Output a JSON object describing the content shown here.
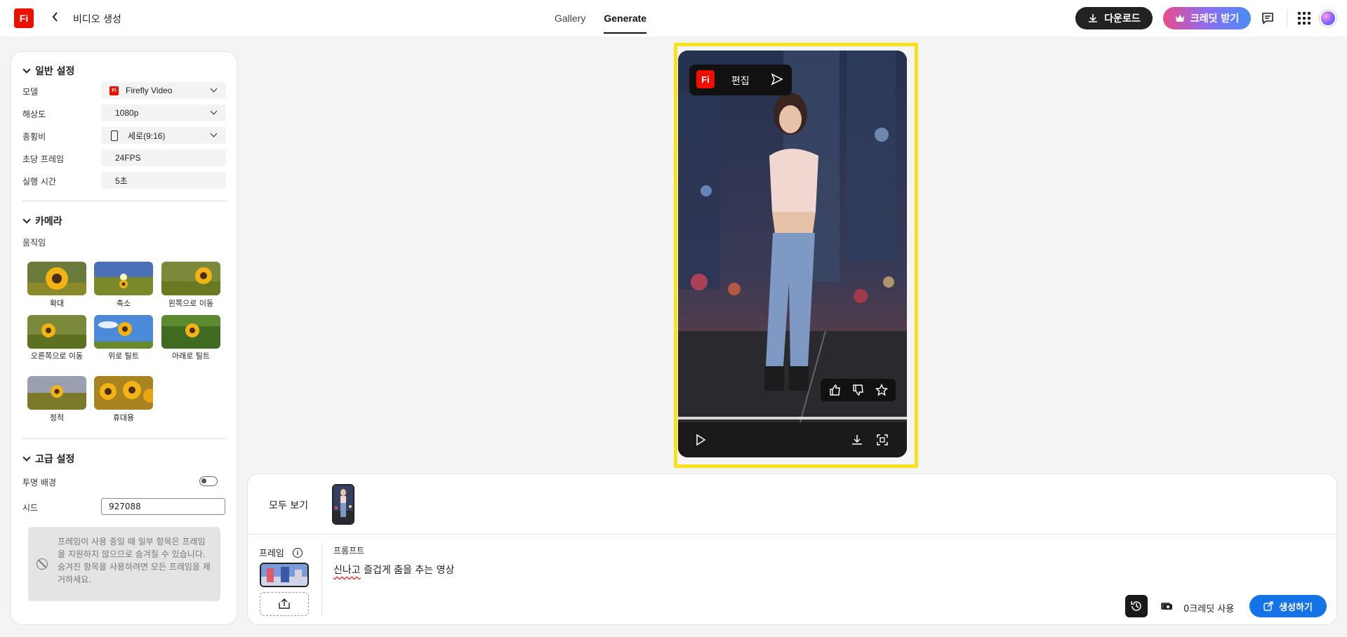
{
  "app": {
    "logo": "Fi",
    "title": "비디오 생성",
    "back_icon": "chevron-left-icon"
  },
  "tabs": [
    {
      "label": "Gallery",
      "active": false
    },
    {
      "label": "Generate",
      "active": true
    }
  ],
  "header": {
    "download_label": "다운로드",
    "credit_label": "크레딧 받기"
  },
  "general": {
    "title": "일반 설정",
    "fields": [
      {
        "label": "모델",
        "value": "Firefly Video"
      },
      {
        "label": "해상도",
        "value": "1080p"
      },
      {
        "label": "종횡비",
        "value": "세로(9:16)"
      },
      {
        "label": "초당 프레임",
        "value": "24FPS"
      },
      {
        "label": "실행 시간",
        "value": "5초"
      }
    ]
  },
  "camera": {
    "title": "카메라",
    "motion_label": "움직임",
    "motions": [
      {
        "label": "확대"
      },
      {
        "label": "축소"
      },
      {
        "label": "왼쪽으로 이동"
      },
      {
        "label": "오른쪽으로 이동"
      },
      {
        "label": "위로 틸트"
      },
      {
        "label": "아래로 틸트"
      },
      {
        "label": "정적"
      },
      {
        "label": "휴대용"
      }
    ]
  },
  "advanced": {
    "title": "고급 설정",
    "transparent_label": "투명 배경",
    "transparent_on": false,
    "seed_label": "시드",
    "seed_value": "927088",
    "notice": "프레임이 사용 중일 때 일부 항목은 프레임을 지원하지 않으므로 숨겨질 수 있습니다. 숨겨진 항목을 사용하려면 모든 프레임을 제거하세요."
  },
  "preview": {
    "edit_label": "편집",
    "fi": "Fi"
  },
  "bottom": {
    "see_all": "모두 보기",
    "frame_label": "프레임",
    "prompt_label": "프롬프트",
    "prompt_squiggle": "신나고",
    "prompt_rest": " 즐겁게 춤을 추는 영상",
    "credit_usage": "0크레딧 사용",
    "generate_label": "생성하기"
  },
  "colors": {
    "accent": "#1473e6",
    "brand": "#eb1000",
    "highlight": "#f7e21b"
  }
}
